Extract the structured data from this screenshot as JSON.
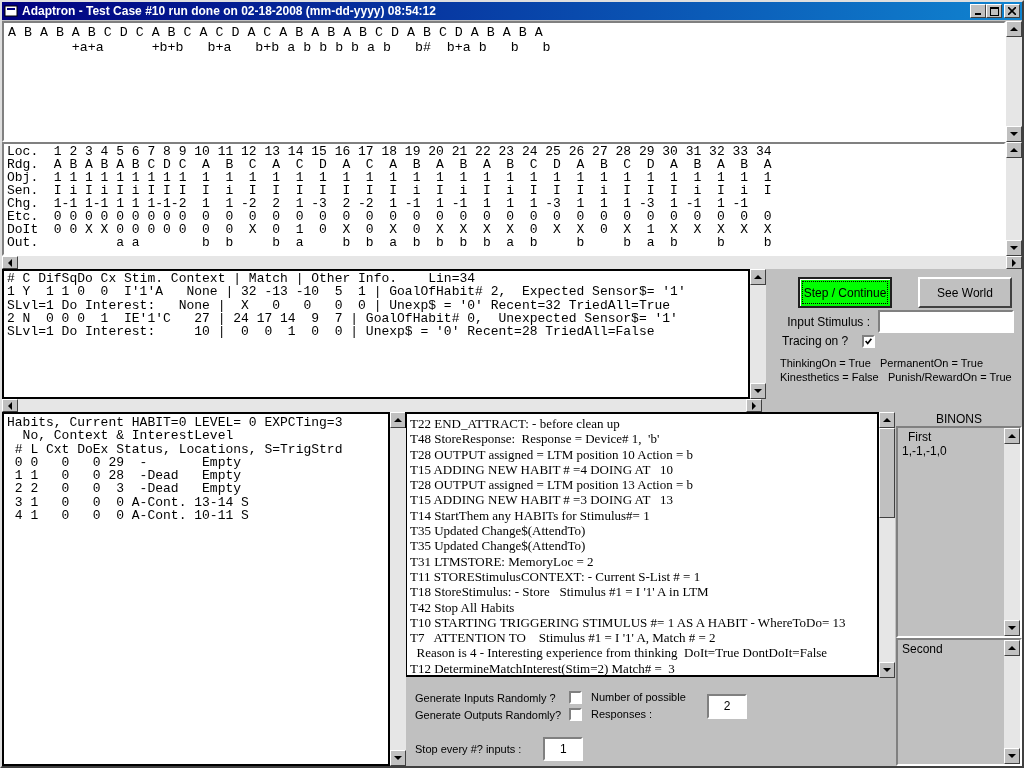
{
  "window": {
    "title": "Adaptron - Test Case #10 run done on 02-18-2008 (mm-dd-yyyy) 08:54:12"
  },
  "stimulus_display": {
    "lines": [
      "A B A B A B C D C A B C A C D A C A B A B A B C D A B C D A B A B A",
      "        +a+a      +b+b   b+a   b+b a b b b b a b   b#  b+a b   b   b"
    ]
  },
  "ltm_table": {
    "lines": [
      "Loc.  1 2 3 4 5 6 7 8 9 10 11 12 13 14 15 16 17 18 19 20 21 22 23 24 25 26 27 28 29 30 31 32 33 34",
      "Rdg.  A B A B A B C D C  A  B  C  A  C  D  A  C  A  B  A  B  A  B  C  D  A  B  C  D  A  B  A  B  A",
      "Obj.  1 1 1 1 1 1 1 1 1  1  1  1  1  1  1  1  1  1  1  1  1  1  1  1  1  1  1  1  1  1  1  1  1  1",
      "Sen.  I i I i I i I I I  I  i  I  I  I  I  I  I  I  i  I  i  I  i  I  I  I  i  I  I  I  i  I  i  I",
      "Chg.  1-1 1-1 1 1 1-1-2  1  1 -2  2  1 -3  2 -2  1 -1  1 -1  1  1  1 -3  1  1  1 -3  1 -1  1 -1",
      "Etc.  0 0 0 0 0 0 0 0 0  0  0  0  0  0  0  0  0  0  0  0  0  0  0  0  0  0  0  0  0  0  0  0  0  0",
      "DoIt  0 0 X X 0 0 0 0 0  0  0  X  0  1  0  X  0  X  0  X  X  X  X  0  X  X  0  X  1  X  X  X  X  X",
      "Out.          a a        b  b     b  a     b  b  a  b  b  b  b  a  b     b     b  a  b     b     b"
    ]
  },
  "match_display": {
    "lines": [
      "# C DifSqDo Cx Stim. Context | Match | Other Info.    Lin=34",
      "1 Y  1 1 0  0  I'1'A   None | 32 -13 -10  5  1 | GoalOfHabit# 2,  Expected Sensor$= '1'",
      "SLvl=1 Do Interest:   None |  X   0   0   0  0 | Unexp$ = '0' Recent=32 TriedAll=True",
      "2 N  0 0 0  1  IE'1'C   27 | 24 17 14  9  7 | GoalOfHabit# 0,  Unexpected Sensor$= '1'",
      "SLvl=1 Do Interest:     10 |  0  0  1  0  0 | Unexp$ = '0' Recent=28 TriedAll=False"
    ]
  },
  "controls": {
    "step_button": {
      "label": "Step / Continue",
      "focused": true
    },
    "see_world_button": {
      "label": "See World"
    },
    "input_stimulus": {
      "label": "Input Stimulus :"
    },
    "tracing": {
      "label": "Tracing on ?",
      "checked": true
    },
    "status_lines": [
      "ThinkingOn = True   PermanentOn = True",
      "Kinesthetics = False   Punish/RewardOn = True"
    ]
  },
  "habits": {
    "lines": [
      "Habits, Current HABIT=0 LEVEL= 0 EXPCTing=3",
      "  No, Context & InterestLevel",
      " # L Cxt DoEx Status, Locations, S=TrigStrd",
      " 0 0   0   0 29  -       Empty",
      " 1 1   0   0 28  -Dead   Empty",
      " 2 2   0   0  3  -Dead   Empty",
      " 3 1   0   0  0 A-Cont. 13-14 S",
      " 4 1   0   0  0 A-Cont. 10-11 S"
    ]
  },
  "trace_log": {
    "lines": [
      "T22 END_ATTRACT: - before clean up",
      "T48 StoreResponse:  Response = Device# 1,  'b'",
      "T28 OUTPUT assigned = LTM position 10 Action = b",
      "T15 ADDING NEW HABIT # =4 DOING AT   10",
      "T28 OUTPUT assigned = LTM position 13 Action = b",
      "T15 ADDING NEW HABIT # =3 DOING AT   13",
      "T14 StartThem any HABITs for Stimulus#= 1",
      "T35 Updated Change$(AttendTo)",
      "T35 Updated Change$(AttendTo)",
      "T31 LTMSTORE: MemoryLoc = 2",
      "T11 STOREStimulusCONTEXT: - Current S-List # = 1",
      "T18 StoreStimulus: - Store   Stimulus #1 = I '1' A in LTM",
      "T42 Stop All Habits",
      "T10 STARTING TRIGGERING STIMULUS #= 1 AS A HABIT - WhereToDo= 13",
      "T7   ATTENTION TO    Stimulus #1 = I '1' A, Match # = 2",
      "  Reason is 4 - Interesting experience from thinking  DoIt=True DontDoIt=False",
      "T12 DetermineMatchInterest(Stim=2) Match# =  3"
    ]
  },
  "options": {
    "generate_inputs": {
      "label": "Generate Inputs Randomly ?",
      "checked": false
    },
    "generate_outputs": {
      "label": "Generate Outputs Randomly?",
      "checked": false
    },
    "responses": {
      "label": "Number of possible Responses :",
      "value": "2"
    },
    "stop_every": {
      "label": "Stop every #? inputs :",
      "value": "1"
    }
  },
  "binons": {
    "title": "BINONS",
    "first": {
      "label": "First",
      "lines": [
        "1,-1,-1,0"
      ]
    },
    "second": {
      "label": "Second"
    }
  }
}
